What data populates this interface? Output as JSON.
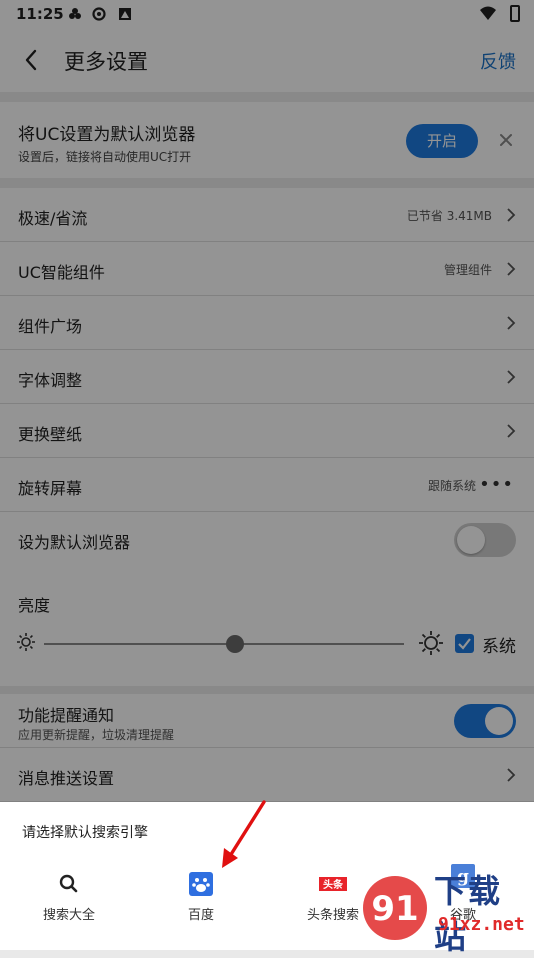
{
  "status_bar": {
    "time": "11:25"
  },
  "header": {
    "title": "更多设置",
    "feedback": "反馈"
  },
  "banner": {
    "title": "将UC设置为默认浏览器",
    "subtitle": "设置后，链接将自动使用UC打开",
    "button": "开启"
  },
  "rows": [
    {
      "label": "极速/省流",
      "value": "已节省 3.41MB"
    },
    {
      "label": "UC智能组件",
      "value": "管理组件"
    },
    {
      "label": "组件广场"
    },
    {
      "label": "字体调整"
    },
    {
      "label": "更换壁纸"
    },
    {
      "label": "旋转屏幕",
      "value": "跟随系统"
    },
    {
      "label": "设为默认浏览器",
      "toggle": false
    }
  ],
  "brightness": {
    "label": "亮度",
    "level": 0.53,
    "system_label": "系统",
    "system_checked": true
  },
  "notifications": {
    "label": "功能提醒通知",
    "subtitle": "应用更新提醒，垃圾清理提醒",
    "toggle": true
  },
  "push_settings": {
    "label": "消息推送设置"
  },
  "sheet": {
    "title": "请选择默认搜索引擎",
    "engines": [
      {
        "label": "搜索大全",
        "icon": "search-icon"
      },
      {
        "label": "百度",
        "icon": "baidu-paw-icon"
      },
      {
        "label": "头条搜索",
        "icon": "toutiao-icon",
        "icon_text": "头条"
      },
      {
        "label": "谷歌",
        "icon": "google-icon",
        "icon_text": "g"
      }
    ]
  },
  "watermark": {
    "top": "下载站",
    "bottom": "91xz.net",
    "logo_text": "91"
  },
  "colors": {
    "accent": "#1e7ae0",
    "overlay": "rgba(0,0,0,0.42)"
  }
}
